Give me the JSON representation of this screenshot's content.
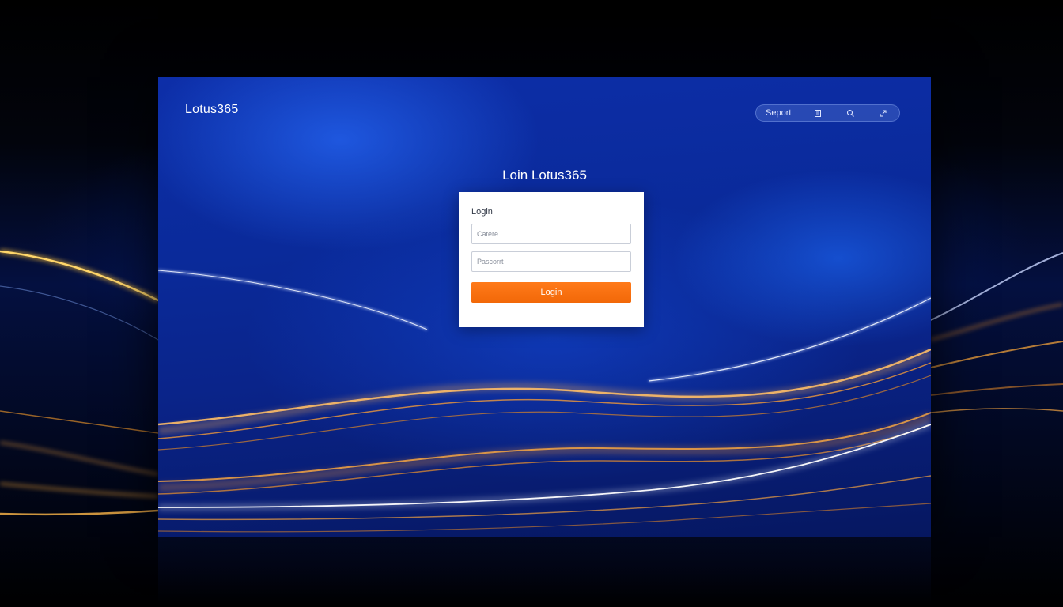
{
  "app": {
    "brand": "Lotus365"
  },
  "topbar": {
    "support_label": "Seport",
    "icons": [
      "document-icon",
      "search-icon",
      "expand-icon"
    ]
  },
  "login": {
    "heading": "Loin Lotus365",
    "card_title": "Login",
    "username_placeholder": "Catere",
    "password_placeholder": "Pascorrt",
    "submit_label": "Login"
  },
  "colors": {
    "background_blue": "#0a2a9a",
    "accent_orange": "#f26808",
    "wave_gold": "#f5a623",
    "card_background": "#ffffff"
  }
}
